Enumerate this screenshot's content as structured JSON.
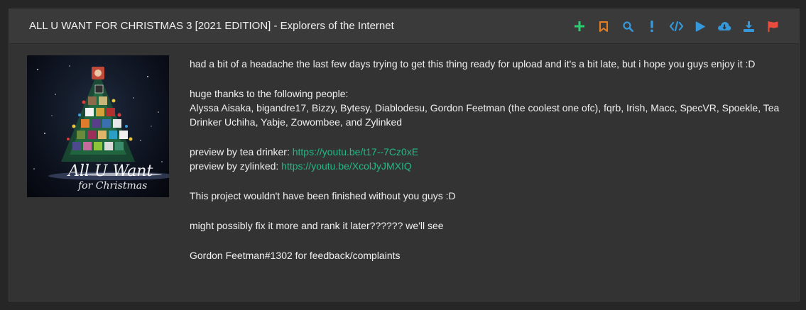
{
  "header": {
    "title": "ALL U WANT FOR CHRISTMAS 3 [2021 EDITION] - Explorers of the Internet"
  },
  "toolbar": {
    "buttons": [
      {
        "icon": "plus-icon",
        "color": "#2ecc71"
      },
      {
        "icon": "bookmark-icon",
        "color": "#e67e22"
      },
      {
        "icon": "search-icon",
        "color": "#3498db"
      },
      {
        "icon": "exclamation-icon",
        "color": "#3498db"
      },
      {
        "icon": "code-icon",
        "color": "#3498db"
      },
      {
        "icon": "play-icon",
        "color": "#3498db"
      },
      {
        "icon": "cloud-download-icon",
        "color": "#3498db"
      },
      {
        "icon": "download-icon",
        "color": "#3498db"
      },
      {
        "icon": "flag-icon",
        "color": "#e74c3c"
      }
    ]
  },
  "cover": {
    "script_text_line1": "All U Want",
    "script_text_line2": "for Christmas"
  },
  "description": {
    "p1": "had a bit of a headache the last few days trying to get this thing ready for upload and it's a bit late, but i hope you guys enjoy it :D",
    "p2_line1": "huge thanks to the following people:",
    "p2_line2": "Alyssa Aisaka, bigandre17, Bizzy, Bytesy, Diablodesu, Gordon Feetman (the coolest one ofc), fqrb, Irish, Macc, SpecVR, Spoekle, Tea Drinker Uchiha, Yabje, Zowombee, and Zylinked",
    "preview1_label": "preview by tea drinker: ",
    "preview1_link": "https://youtu.be/t17--7Cz0xE",
    "preview2_label": "preview by zylinked: ",
    "preview2_link": "https://youtu.be/XcolJyJMXIQ",
    "p4": "This project wouldn't have been finished without you guys :D",
    "p5": "might possibly fix it more and rank it later?????? we'll see",
    "p6": "Gordon Feetman#1302 for feedback/complaints"
  },
  "colors": {
    "link": "#22b887",
    "background": "#262626",
    "panel": "#333333"
  }
}
